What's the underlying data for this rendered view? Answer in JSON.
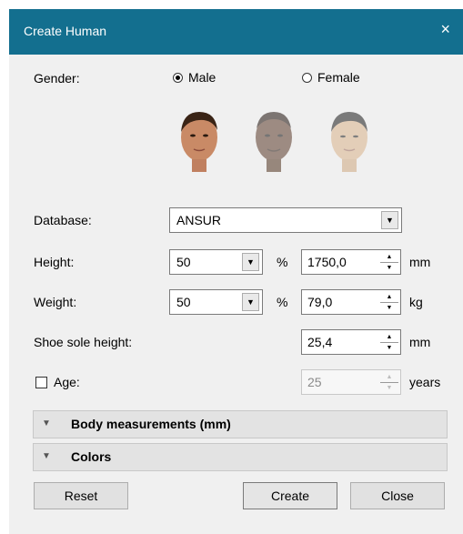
{
  "window": {
    "title": "Create Human",
    "close_glyph": "×"
  },
  "gender": {
    "label": "Gender:",
    "options": [
      {
        "label": "Male",
        "checked": true
      },
      {
        "label": "Female",
        "checked": false
      }
    ]
  },
  "faces": [
    "face-light-skin",
    "face-dark-skin",
    "face-asian"
  ],
  "database": {
    "label": "Database:",
    "value": "ANSUR"
  },
  "height": {
    "label": "Height:",
    "percentile": "50",
    "percent_sign": "%",
    "value": "1750,0",
    "unit": "mm"
  },
  "weight": {
    "label": "Weight:",
    "percentile": "50",
    "percent_sign": "%",
    "value": "79,0",
    "unit": "kg"
  },
  "shoe": {
    "label": "Shoe sole height:",
    "value": "25,4",
    "unit": "mm"
  },
  "age": {
    "label": "Age:",
    "checked": false,
    "value": "25",
    "unit": "years"
  },
  "sections": [
    {
      "title": "Body measurements (mm)"
    },
    {
      "title": "Colors"
    }
  ],
  "buttons": {
    "reset": "Reset",
    "create": "Create",
    "close": "Close"
  },
  "colors": {
    "titlebar": "#136f8f"
  }
}
